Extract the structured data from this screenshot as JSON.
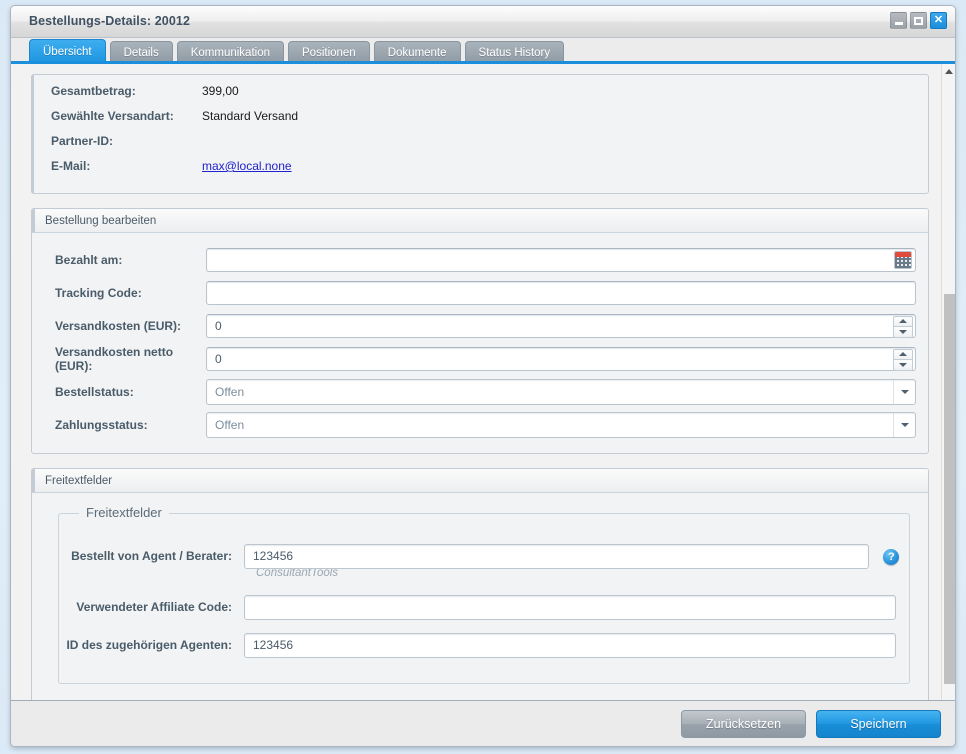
{
  "window": {
    "title": "Bestellungs-Details: 20012",
    "controls": {
      "minimize": "minimize-button",
      "maximize": "maximize-button",
      "close": "✕"
    }
  },
  "tabs": [
    {
      "label": "Übersicht",
      "active": true
    },
    {
      "label": "Details",
      "active": false
    },
    {
      "label": "Kommunikation",
      "active": false
    },
    {
      "label": "Positionen",
      "active": false
    },
    {
      "label": "Dokumente",
      "active": false
    },
    {
      "label": "Status History",
      "active": false
    }
  ],
  "summary": {
    "rows": [
      {
        "label": "Gesamtbetrag:",
        "value": "399,00",
        "link": false
      },
      {
        "label": "Gewählte Versandart:",
        "value": "Standard Versand",
        "link": false
      },
      {
        "label": "Partner-ID:",
        "value": "",
        "link": false
      },
      {
        "label": "E-Mail:",
        "value": "max@local.none",
        "link": true
      }
    ]
  },
  "edit_panel": {
    "title": "Bestellung bearbeiten",
    "fields": {
      "paid_on": {
        "label": "Bezahlt am:",
        "value": "",
        "placeholder": ""
      },
      "tracking_code": {
        "label": "Tracking Code:",
        "value": "",
        "placeholder": ""
      },
      "shipping_gross": {
        "label": "Versandkosten (EUR):",
        "value": "0",
        "placeholder": ""
      },
      "shipping_net": {
        "label": "Versandkosten netto (EUR):",
        "value": "0",
        "placeholder": ""
      },
      "order_status": {
        "label": "Bestellstatus:",
        "value": "Offen"
      },
      "payment_status": {
        "label": "Zahlungsstatus:",
        "value": "Offen"
      }
    }
  },
  "freetext_panel": {
    "title": "Freitextfelder",
    "legend": "Freitextfelder",
    "fields": {
      "agent": {
        "label": "Bestellt von Agent / Berater:",
        "value": "123456",
        "hint": "ConsultantTools",
        "help": "?"
      },
      "affiliate": {
        "label": "Verwendeter Affiliate Code:",
        "value": ""
      },
      "agent_id": {
        "label": "ID des zugehörigen Agenten:",
        "value": "123456"
      }
    }
  },
  "footer": {
    "reset_label": "Zurücksetzen",
    "save_label": "Speichern"
  },
  "colors": {
    "accent": "#1b8fdc",
    "tab_inactive": "#8d99a3",
    "link": "#2222cc",
    "calendar_top": "#e24a3c"
  }
}
